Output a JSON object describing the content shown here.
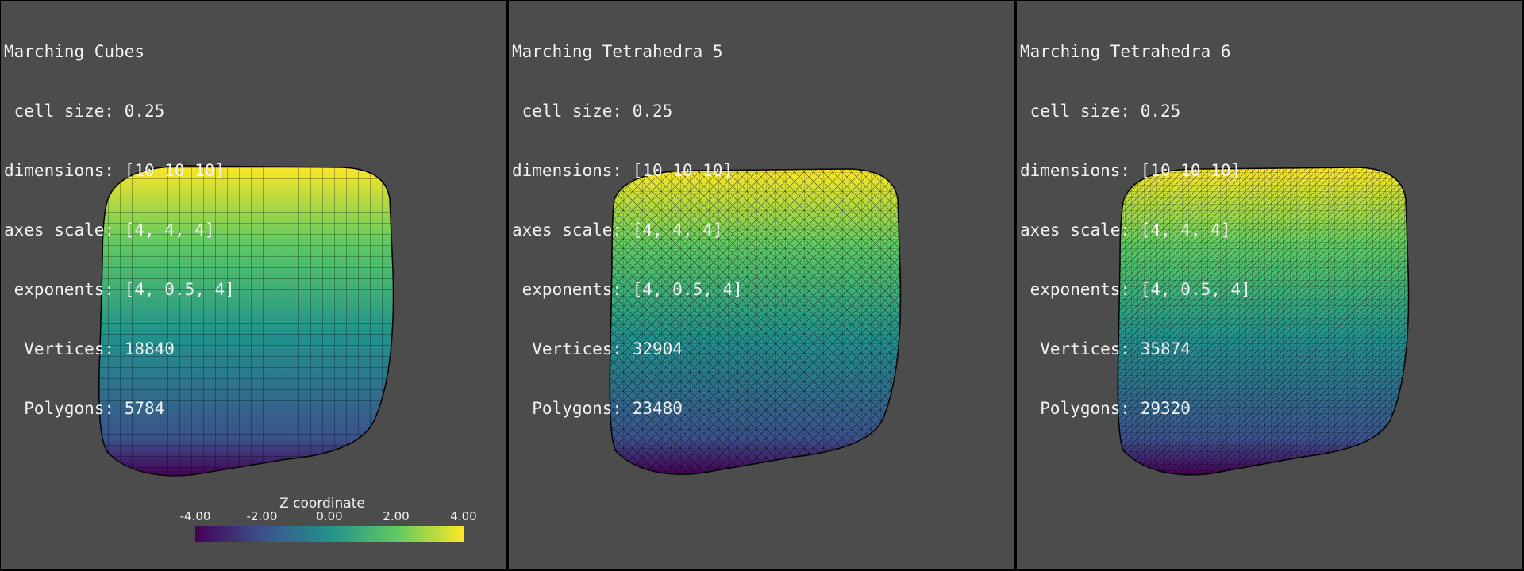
{
  "panels": [
    {
      "title": "Marching Cubes",
      "cell_size": " cell size: 0.25",
      "dimensions": "dimensions: [10 10 10]",
      "axes_scale": "axes scale: [4, 4, 4]",
      "exponents": " exponents: [4, 0.5, 4]",
      "vertices": "  Vertices: 18840",
      "polygons": "  Polygons: 5784"
    },
    {
      "title": "Marching Tetrahedra 5",
      "cell_size": " cell size: 0.25",
      "dimensions": "dimensions: [10 10 10]",
      "axes_scale": "axes scale: [4, 4, 4]",
      "exponents": " exponents: [4, 0.5, 4]",
      "vertices": "  Vertices: 32904",
      "polygons": "  Polygons: 23480"
    },
    {
      "title": "Marching Tetrahedra 6",
      "cell_size": " cell size: 0.25",
      "dimensions": "dimensions: [10 10 10]",
      "axes_scale": "axes scale: [4, 4, 4]",
      "exponents": " exponents: [4, 0.5, 4]",
      "vertices": "  Vertices: 35874",
      "polygons": "  Polygons: 29320"
    }
  ],
  "colorbar": {
    "title": "Z coordinate",
    "ticks": [
      "-4.00",
      "-2.00",
      "0.00",
      "2.00",
      "4.00"
    ],
    "colormap": "viridis",
    "colors": [
      "#440154",
      "#3b528b",
      "#21918c",
      "#5ec962",
      "#fde725"
    ]
  },
  "colors": {
    "background": "#4c4c4c",
    "text": "#f2f2f2",
    "mesh_edges": "#000000"
  }
}
